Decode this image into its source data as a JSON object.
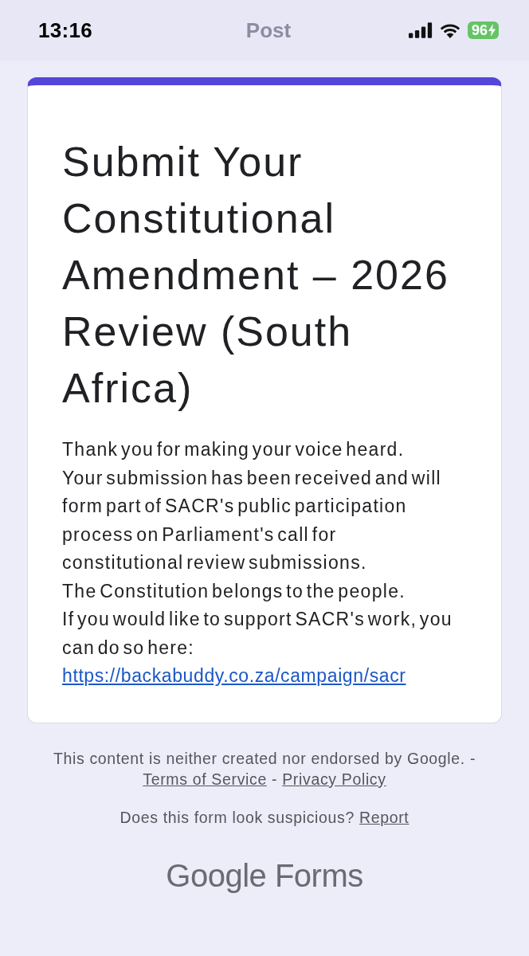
{
  "status_bar": {
    "time": "13:16",
    "title": "Post",
    "battery": "96",
    "charging": true
  },
  "form": {
    "title": "Submit Your Constitutional Amendment – 2026 Review (South Africa)",
    "message": {
      "lines": [
        "Thank you for making your voice heard.",
        "Your submission has been received and will form part of SACR's public participation process on Parliament's call for constitutional review submissions.",
        "The Constitution belongs to the people.",
        "If you would like to support SACR's work, you can do so here:"
      ],
      "link": "https://backabuddy.co.za/campaign/sacr"
    }
  },
  "footer": {
    "disclaimer": "This content is neither created nor endorsed by Google. -",
    "links": [
      "Terms of Service",
      "Privacy Policy"
    ],
    "separator": "-",
    "report_question": "Does this form look suspicious?",
    "report_link": "Report",
    "brand": "Google Forms"
  }
}
